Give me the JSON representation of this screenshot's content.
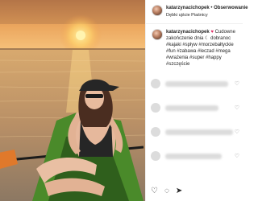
{
  "header": {
    "username": "katarzynacichopek",
    "separator": " • ",
    "follow_label": "Obserwowanie",
    "location": "Dębki ujście Piaśnicy"
  },
  "caption": {
    "username": "katarzynacichopek",
    "text": "Cudowne zakończenie dnia",
    "text2": "dobranoc",
    "hashtags": "#kajaki #spływ #morzebałtyckie #fun #zabawa #leczad #mega #wrażenia #super #happy #szczęście",
    "heart_icon": "♥",
    "moon_icon": "☾"
  },
  "comments": {
    "like_icon": "♡"
  },
  "actions": {
    "heart": "♡",
    "comment": "◌",
    "share": "➤"
  },
  "colors": {
    "sky_top": "#f0b35a",
    "sun": "#ffd86b",
    "water": "#b2895a",
    "kayak": "#4a8a2a",
    "accent_heart": "#e0245e"
  }
}
